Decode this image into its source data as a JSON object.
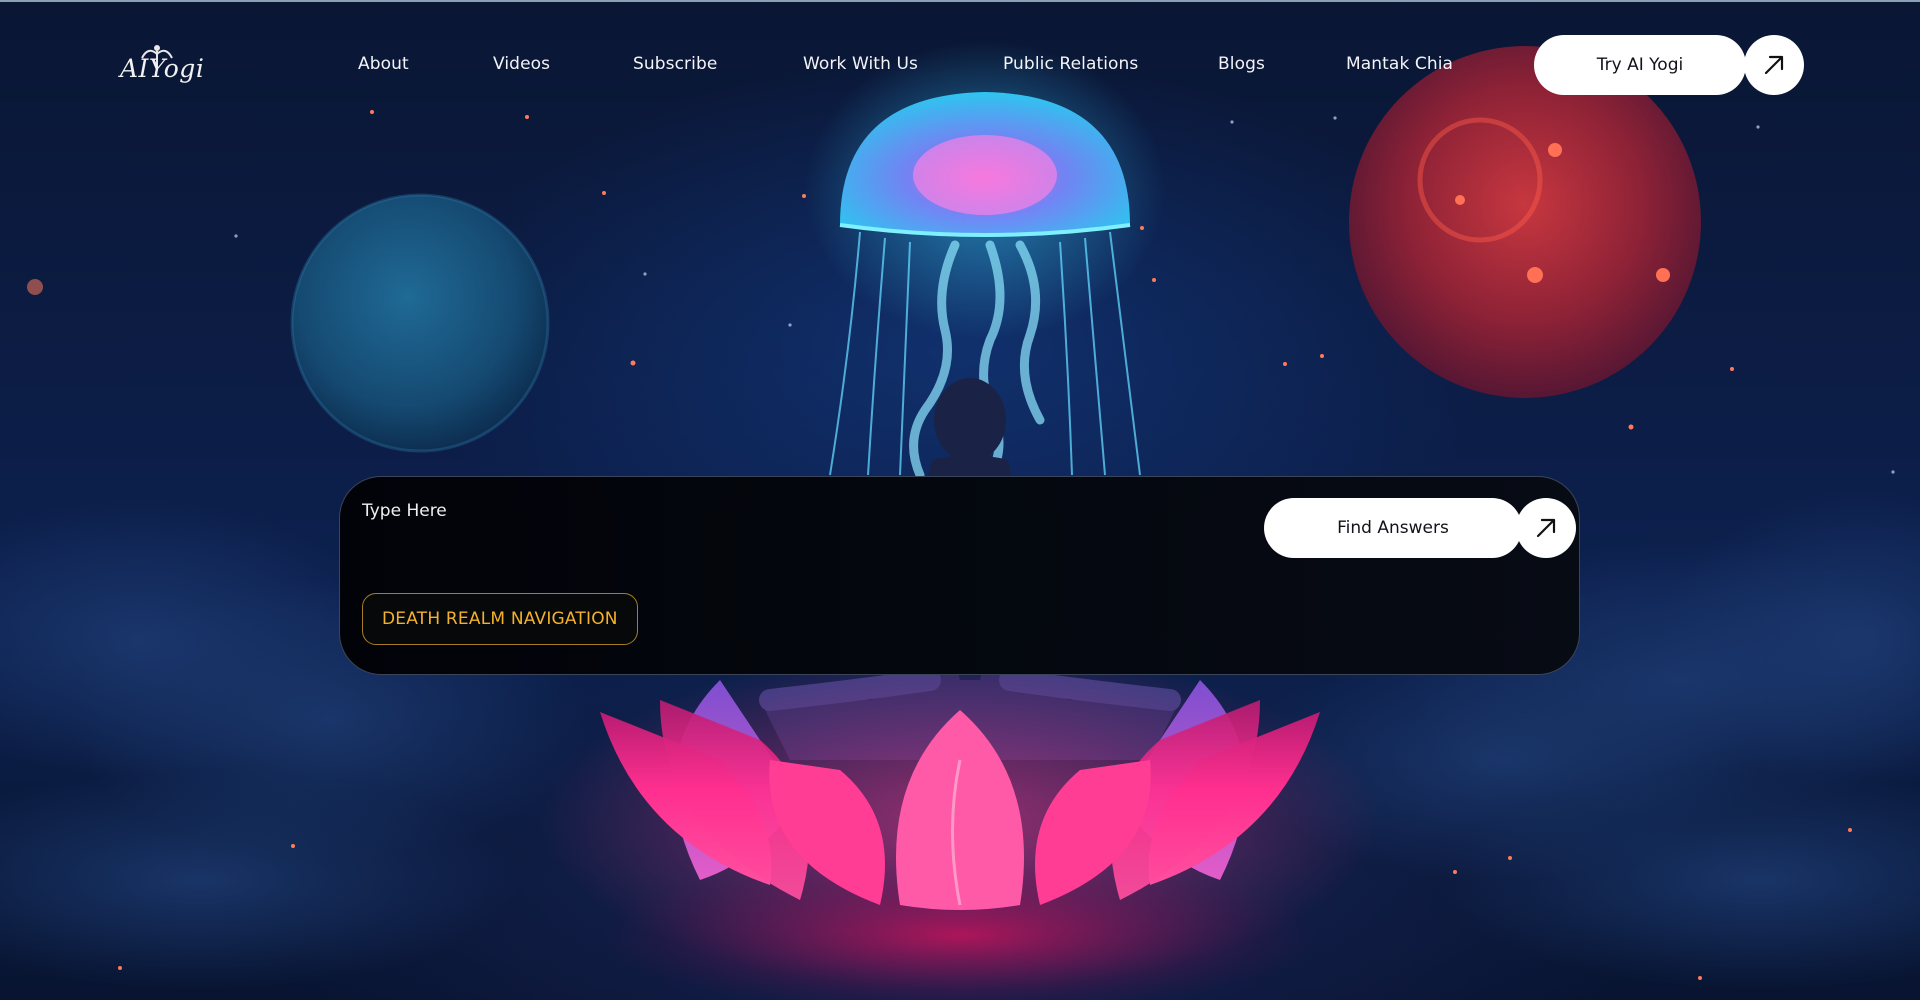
{
  "brand": {
    "logo_text": "AIYogi"
  },
  "nav": {
    "links": [
      {
        "label": "About"
      },
      {
        "label": "Videos"
      },
      {
        "label": "Subscribe"
      },
      {
        "label": "Work With Us"
      },
      {
        "label": "Public Relations"
      },
      {
        "label": "Blogs"
      },
      {
        "label": "Mantak Chia"
      }
    ],
    "cta_label": "Try AI Yogi",
    "cta_icon": "arrow-up-right-icon"
  },
  "search": {
    "placeholder": "Type Here",
    "submit_label": "Find Answers",
    "submit_icon": "arrow-up-right-icon",
    "chip_label": "DEATH REALM NAVIGATION"
  },
  "colors": {
    "background": "#0c1d46",
    "button": "#ffffff",
    "panel": "#04070e",
    "chip_accent": "#f4b22c",
    "jellyfish": "#3fd6ff",
    "lotus": "#ff2f8f",
    "red_planet": "#c7373f"
  }
}
